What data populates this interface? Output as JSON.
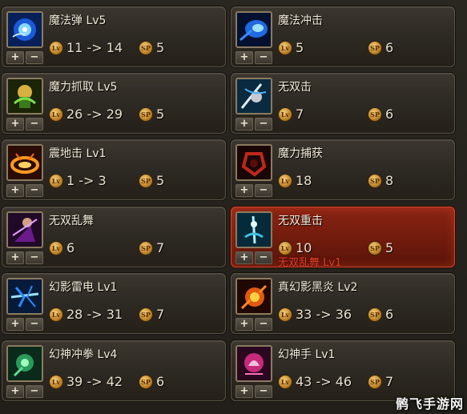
{
  "colors": {
    "panel_bg": "#221f1a",
    "slot_border": "#5a5246",
    "active_bg": "#7a1e10",
    "text": "#f2ead8",
    "badge_gold": "#c48a2e",
    "overlay_red": "#e0402a"
  },
  "badges": {
    "lv": "Lv",
    "sp": "SP"
  },
  "buttons": {
    "plus": "+",
    "minus": "−"
  },
  "skills": [
    {
      "name": "魔法弹 Lv5",
      "lv": "11 -> 14",
      "sp": "5",
      "icon": "magic-bullet-icon"
    },
    {
      "name": "魔法冲击",
      "lv": "5",
      "sp": "6",
      "icon": "magic-impact-icon"
    },
    {
      "name": "魔力抓取 Lv5",
      "lv": "26 -> 29",
      "sp": "5",
      "icon": "mana-grab-icon"
    },
    {
      "name": "无双击",
      "lv": "7",
      "sp": "6",
      "icon": "peerless-strike-icon"
    },
    {
      "name": "震地击 Lv1",
      "lv": "1 -> 3",
      "sp": "5",
      "icon": "ground-slam-icon"
    },
    {
      "name": "魔力捕获",
      "lv": "18",
      "sp": "8",
      "icon": "mana-capture-icon"
    },
    {
      "name": "无双乱舞",
      "lv": "6",
      "sp": "7",
      "icon": "peerless-dance-icon"
    },
    {
      "name": "无双重击",
      "lv": "10",
      "sp": "5",
      "icon": "peerless-heavy-strike-icon",
      "active": true,
      "overlay": "无双乱舞 Lv1"
    },
    {
      "name": "幻影雷电 Lv1",
      "lv": "28 -> 31",
      "sp": "7",
      "icon": "phantom-thunder-icon"
    },
    {
      "name": "真幻影黑炎 Lv2",
      "lv": "33 -> 36",
      "sp": "6",
      "icon": "black-flame-icon"
    },
    {
      "name": "幻神冲拳 Lv4",
      "lv": "39 -> 42",
      "sp": "6",
      "icon": "phantom-punch-icon"
    },
    {
      "name": "幻神手 Lv1",
      "lv": "43 -> 46",
      "sp": "7",
      "icon": "phantom-hand-icon"
    }
  ],
  "watermark": "鹘飞手游网"
}
